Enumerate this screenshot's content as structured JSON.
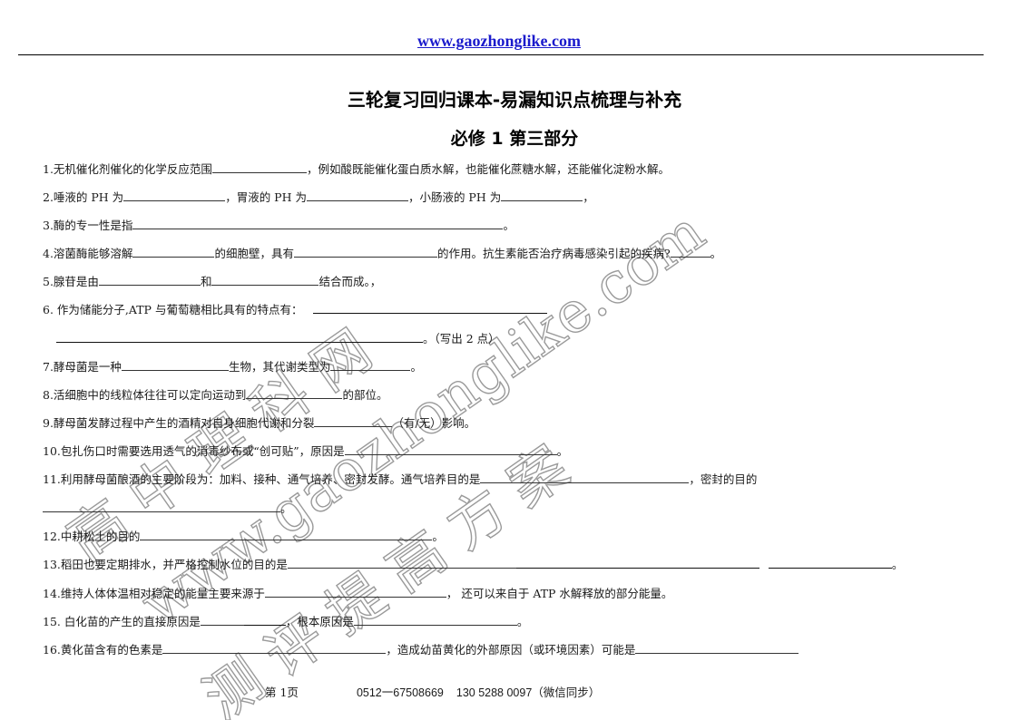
{
  "header": {
    "url": "www.gaozhonglike.com"
  },
  "document": {
    "title": "三轮复习回归课本-易漏知识点梳理与补充",
    "subtitle": "必修 1 第三部分"
  },
  "questions": [
    {
      "parts": [
        "1.无机催化剂催化的化学反应范围",
        "，例如酸既能催化蛋白质水解，也能催化蔗糖水解，还能催化淀粉水解。"
      ]
    },
    {
      "parts": [
        "2.唾液的 PH 为",
        "，胃液的 PH 为",
        "，小肠液的 PH 为",
        "，"
      ]
    },
    {
      "parts": [
        "3.酶的专一性是指",
        "。"
      ]
    },
    {
      "parts": [
        "4.溶菌酶能够溶解",
        "的细胞壁，具有",
        "的作用。抗生素能否治疗病毒感染引起的疾病?",
        "。"
      ]
    },
    {
      "parts": [
        "5.腺苷是由",
        "和",
        "结合而成。，"
      ]
    },
    {
      "parts": [
        "6.  作为储能分子,ATP 与葡萄糖相比具有的特点有：",
        "",
        "。（写出 2 点）"
      ]
    },
    {
      "parts": [
        "7.酵母菌是一种",
        "生物，其代谢类型为",
        "。"
      ]
    },
    {
      "parts": [
        "8.活细胞中的线粒体往往可以定向运动到",
        "的部位。"
      ]
    },
    {
      "parts": [
        "9.酵母菌发酵过程中产生的酒精对自身细胞代谢和分裂",
        "（有/无）影响。"
      ]
    },
    {
      "parts": [
        "10.包扎伤口时需要选用透气的消毒纱布或“创可贴”，原因是",
        "。"
      ]
    },
    {
      "parts": [
        "11.利用酵母菌酿酒的主要阶段为：加料、接种、通气培养、密封发酵。通气培养目的是",
        "，密封的目的",
        "。"
      ]
    },
    {
      "parts": [
        "12.中耕松土的目的",
        "。"
      ]
    },
    {
      "parts": [
        "13.稻田也要定期排水，并严格控制水位的目的是",
        "。"
      ]
    },
    {
      "parts": [
        "14.维持人体体温相对稳定的能量主要来源于",
        "，  还可以来自于 ATP 水解释放的部分能量。"
      ]
    },
    {
      "parts": [
        "15.  白化苗的产生的直接原因是",
        "，根本原因是",
        "。"
      ]
    },
    {
      "parts": [
        "16.黄化苗含有的色素是",
        "，造成幼苗黄化的外部原因（或环境因素）可能是",
        ""
      ]
    }
  ],
  "footer": {
    "page": "第 1页",
    "phone": "0512一67508669",
    "phone2": "130 5288 0097（微信同步）"
  },
  "watermark": {
    "line1": "www.gaozhonglike.com",
    "line2": "高 中 理 科 网",
    "line3": "测 评 提 高 方 案"
  }
}
